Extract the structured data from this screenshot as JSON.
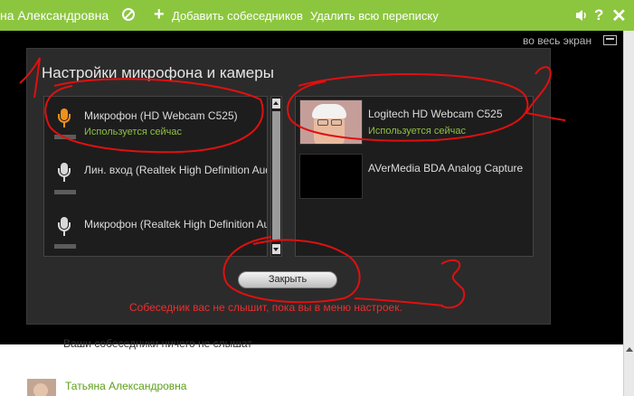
{
  "topbar": {
    "title": "на Александровна",
    "add_label": "Добавить собеседников",
    "delete_label": "Удалить всю переписку",
    "help_label": "?",
    "close_label": "✕",
    "bg_color": "#8cc63f"
  },
  "video": {
    "fullscreen_label": "во весь экран"
  },
  "dialog": {
    "title": "Настройки микрофона и камеры",
    "microphones": [
      {
        "name": "Микрофон (HD Webcam C525)",
        "status": "Используется сейчас",
        "active": true
      },
      {
        "name": "Лин. вход (Realtek High Definition Audio)",
        "status": "",
        "active": false
      },
      {
        "name": "Микрофон (Realtek High Definition Audio)",
        "status": "",
        "active": false
      }
    ],
    "cameras": [
      {
        "name": "Logitech HD Webcam C525",
        "status": "Используется сейчас",
        "has_preview": true
      },
      {
        "name": "AVerMedia BDA Analog Capture",
        "status": "",
        "has_preview": false
      }
    ],
    "close_button": "Закрыть",
    "warning": "Собеседник вас не слышит, пока вы в меню настроек."
  },
  "below": {
    "cut_text": "Ваши собеседники ничего не слышат",
    "contact_name": "Татьяна Александровна"
  },
  "annotations": {
    "labels": [
      "1",
      "2",
      "3"
    ],
    "color": "#e01010"
  }
}
